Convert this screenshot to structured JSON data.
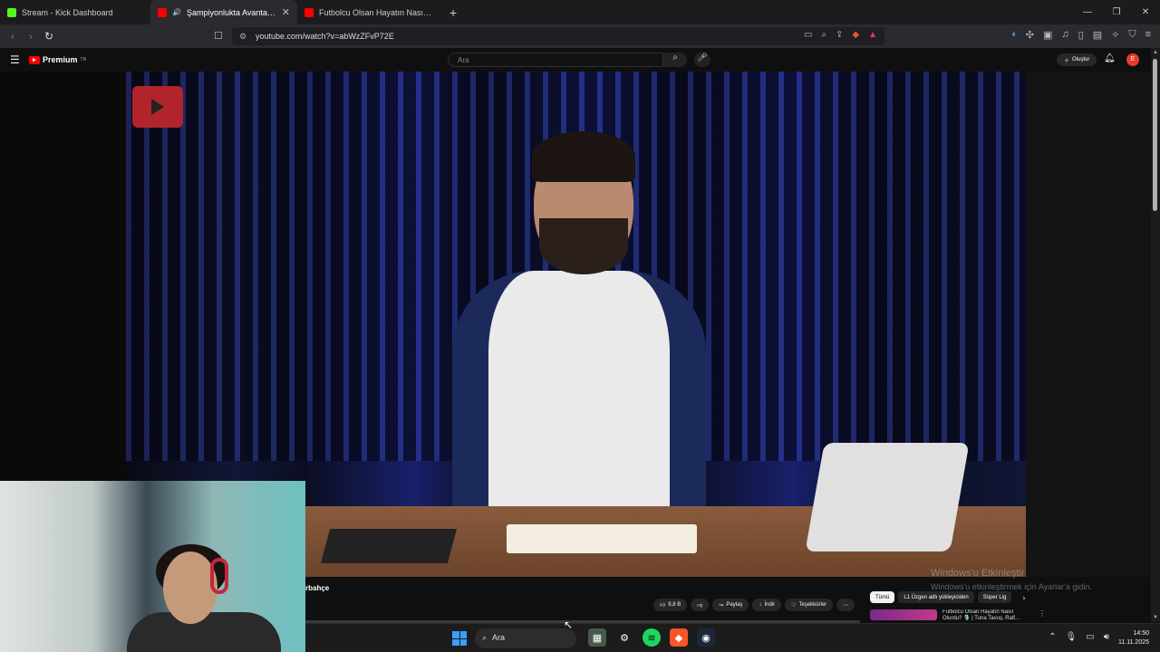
{
  "browser": {
    "tabs": [
      {
        "label": "Stream - Kick Dashboard",
        "fav_color": "#53fc18"
      },
      {
        "label": "Şampiyonlukta Avantaj Kimde",
        "fav_color": "#ff0000"
      },
      {
        "label": "Futbolcu Olsan Hayatın Nasıl Olurdu",
        "fav_color": "#ff0000"
      }
    ],
    "new_tab": "+",
    "url": "youtube.com/watch?v=abWzZFvP72E"
  },
  "youtube": {
    "logo_text": "Premium",
    "logo_sup": "TR",
    "search_placeholder": "Ara",
    "create_label": "Oluştur",
    "avatar_letter": "E"
  },
  "video": {
    "title_fragment": "rbahçe",
    "actions": {
      "likes": "9,8 B",
      "share": "Paylaş",
      "download": "İndir",
      "thanks": "Teşekkürler"
    }
  },
  "sidebar": {
    "chips": [
      "Tümü",
      "L1 Üzgen adlı yükleyiciden",
      "Süper Lig"
    ],
    "rec_title": "Futbolcu Olsan Hayatın Nasıl Olurdu? 🎙️ | Tuna Tavuş, Ralf..."
  },
  "windows_activation": {
    "line1": "Windows'u Etkinleştir",
    "line2": "Windows'u etkinleştirmek için Ayarlar'a gidin."
  },
  "taskbar": {
    "search": "Ara",
    "time": "14:50",
    "date": "11.11.2025"
  },
  "colors": {
    "accent_red": "#ff0000",
    "windows_blue": "#3aa0ff"
  }
}
